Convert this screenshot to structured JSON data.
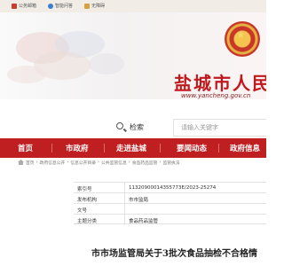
{
  "topbar": {
    "items": [
      {
        "icon": "government-icon",
        "label": "公务邮箱"
      },
      {
        "icon": "robot-icon",
        "label": "智能问答"
      },
      {
        "icon": "accessibility-icon",
        "label": "无障碍"
      }
    ]
  },
  "site": {
    "name": "盐城市人民",
    "url": "www.yancheng.gov.cn",
    "brand_color": "#c01f22"
  },
  "search": {
    "label": "检索",
    "placeholder": "请输入关键字"
  },
  "nav": {
    "items": [
      "首页",
      "市政府",
      "走进盐城",
      "要闻动态",
      "政府信息"
    ]
  },
  "breadcrumb": [
    "首页",
    "政府信息公开",
    "信息公开目录",
    "公共监管信息",
    "食品药品监管",
    "监管执法"
  ],
  "meta": {
    "rows": [
      {
        "key": "索引号",
        "value": "11320900014355773E/2023-25274"
      },
      {
        "key": "发布机构",
        "value": "市市监局"
      },
      {
        "key": "文号",
        "value": ""
      },
      {
        "key": "主题分类",
        "value": "食品药品监管"
      }
    ]
  },
  "article": {
    "title": "市市场监管局关于3批次食品抽检不合格情"
  }
}
